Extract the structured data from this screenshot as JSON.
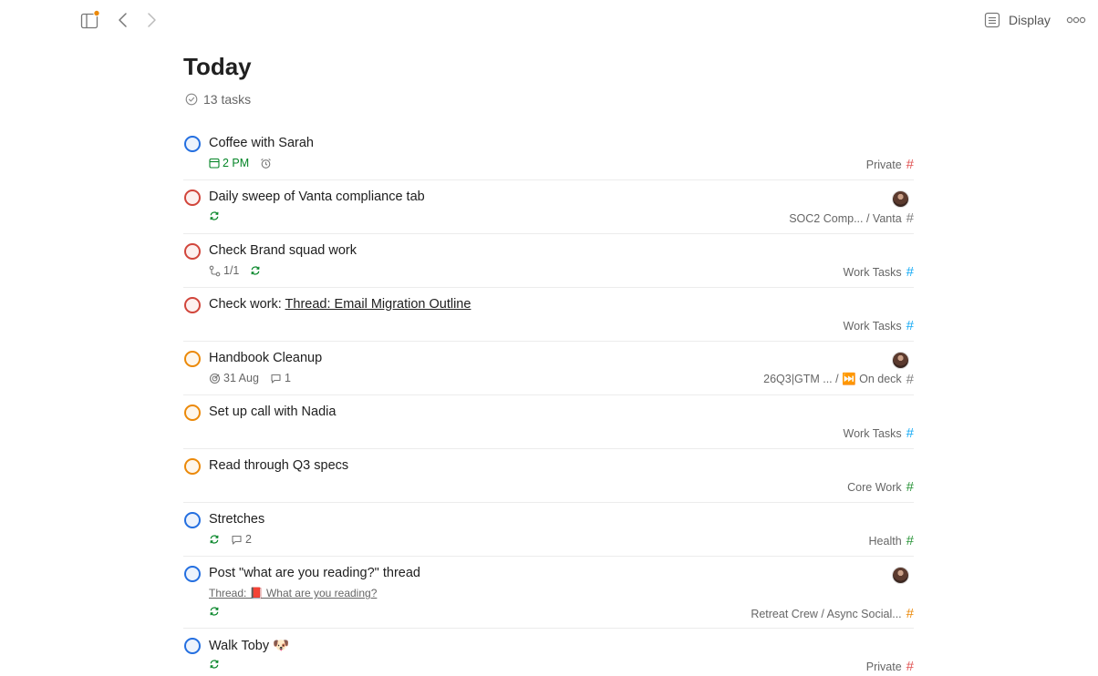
{
  "topbar": {
    "display_label": "Display",
    "notification_color": "#eb8909"
  },
  "page": {
    "title": "Today",
    "task_count": "13 tasks"
  },
  "colors": {
    "p1": "#d1453b",
    "p2": "#eb8909",
    "p3": "#246fe0",
    "due_green": "#058527"
  },
  "tasks": [
    {
      "title": "Coffee with Sarah",
      "priority": "p3",
      "due": "2 PM",
      "reminder": true,
      "project": "Private",
      "hash_color": "#e05252"
    },
    {
      "title": "Daily sweep of Vanta compliance tab",
      "priority": "p1",
      "recurring": true,
      "assignee_avatar": true,
      "project": "SOC2 Comp...  / Vanta",
      "hash_color": "#808080"
    },
    {
      "title": "Check Brand squad work",
      "priority": "p1",
      "subtasks": "1/1",
      "recurring": true,
      "project": "Work Tasks",
      "hash_color": "#14aaf5"
    },
    {
      "title_prefix": "Check work: ",
      "title_link": "Thread: Email Migration Outline",
      "priority": "p1",
      "project": "Work Tasks",
      "hash_color": "#14aaf5"
    },
    {
      "title": "Handbook Cleanup",
      "priority": "p2",
      "deadline": "31 Aug",
      "comments": "1",
      "assignee_avatar": true,
      "project": "26Q3|GTM ...   / ⏭️ On deck",
      "hash_color": "#808080"
    },
    {
      "title": "Set up call with Nadia",
      "priority": "p2",
      "project": "Work Tasks",
      "hash_color": "#14aaf5"
    },
    {
      "title": "Read through Q3 specs",
      "priority": "p2",
      "project": "Core Work",
      "hash_color": "#299438"
    },
    {
      "title": "Stretches",
      "priority": "p3",
      "recurring": true,
      "comments": "2",
      "project": "Health",
      "hash_color": "#299438"
    },
    {
      "title": "Post \"what are you reading?\" thread",
      "priority": "p3",
      "thread_link": "Thread: 📕 What are you reading?",
      "recurring": true,
      "assignee_avatar": true,
      "project": "Retreat Crew / Async Social...",
      "hash_color": "#eb8909"
    },
    {
      "title": "Walk Toby 🐶",
      "priority": "p3",
      "recurring": true,
      "project": "Private",
      "hash_color": "#e05252"
    }
  ]
}
